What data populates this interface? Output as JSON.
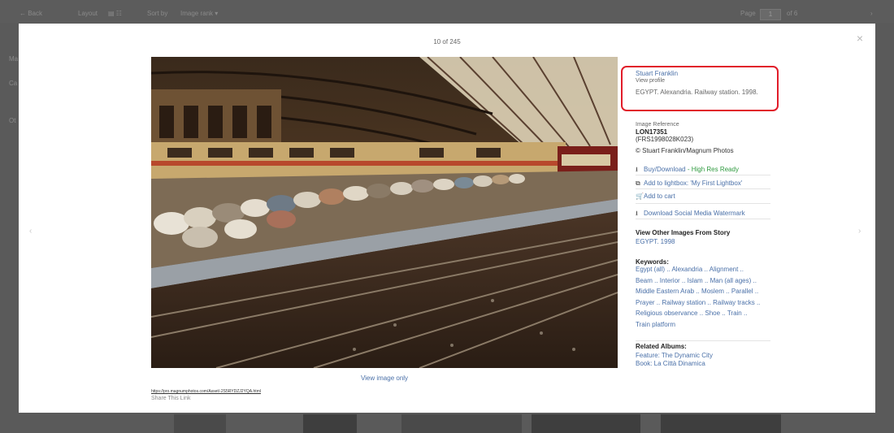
{
  "background": {
    "back": "← Back",
    "layout": "Layout",
    "sort_by": "Sort by",
    "sort_value": "Image rank ▾",
    "page_label": "Page",
    "page_value": "1",
    "page_of": "of 6",
    "sidebar": [
      "Ma",
      "Ca",
      "Ot"
    ]
  },
  "lightbox": {
    "counter": "10 of 245",
    "close": "×",
    "prev": "‹",
    "next": "›",
    "view_image_only": "View image only",
    "share_url": "https://pro.magnumphotos.com/Asset/-2S5RYDZJ2YQA.html",
    "share_link": "Share This Link"
  },
  "info": {
    "photographer": "Stuart Franklin",
    "view_profile": "View profile",
    "caption": "EGYPT. Alexandria. Railway station. 1998.",
    "image_reference_label": "Image Reference",
    "image_reference": "LON17351",
    "image_code": "(FRS1998028K023)",
    "copyright": "© Stuart Franklin/Magnum Photos",
    "actions": {
      "buy": "Buy/Download",
      "buy_suffix": " - High Res Ready",
      "lightbox": "Add to lightbox: 'My First Lightbox'",
      "cart": "Add to cart",
      "watermark": "Download Social Media Watermark"
    },
    "other_images_label": "View Other Images From Story",
    "story": "EGYPT. 1998",
    "keywords_label": "Keywords:",
    "keywords": [
      "Egypt (all)",
      "Alexandria",
      "Alignment",
      "Beam",
      "Interior",
      "Islam",
      "Man (all ages)",
      "Middle Eastern Arab",
      "Moslem",
      "Parallel",
      "Prayer",
      "Railway station",
      "Railway tracks",
      "Religious observance",
      "Shoe",
      "Train",
      "Train platform"
    ],
    "related_albums_label": "Related Albums:",
    "related_albums": [
      "Feature: The Dynamic City",
      "Book: La Città Dinamica"
    ]
  },
  "colors": {
    "link": "#4a70a8",
    "accent_red": "#e11d2a",
    "ready_green": "#2f9a3f"
  },
  "icons": {
    "download": "download-icon",
    "lightbox": "lightbox-icon",
    "cart": "cart-icon",
    "close": "close-icon"
  }
}
